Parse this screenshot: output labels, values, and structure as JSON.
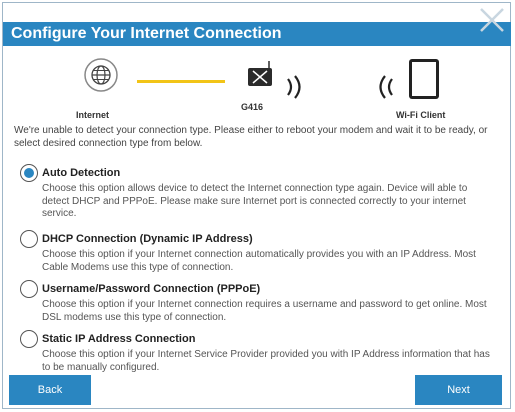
{
  "dialog": {
    "title": "Configure Your Internet Connection",
    "accent_color": "#2a86c1"
  },
  "diagram": {
    "internet_label": "Internet",
    "device_label": "G416",
    "client_label": "Wi-Fi Client",
    "icons": [
      "globe-icon",
      "router-icon",
      "wifi-waves-icon",
      "tablet-icon"
    ]
  },
  "intro_text": "We're unable to detect your connection type. Please either to reboot your modem and wait it to be ready, or select desired connection type from below.",
  "options": [
    {
      "title": "Auto Detection",
      "description": "Choose this option allows device to detect the Internet connection type again. Device will able to detect DHCP and PPPoE. Please make sure Internet port is connected correctly to your internet service.",
      "selected": true
    },
    {
      "title": "DHCP Connection (Dynamic IP Address)",
      "description": "Choose this option if your Internet connection automatically provides you with an IP Address. Most Cable Modems use this type of connection.",
      "selected": false
    },
    {
      "title": "Username/Password Connection (PPPoE)",
      "description": "Choose this option if your Internet connection requires a username and password to get online. Most DSL modems use this type of connection.",
      "selected": false
    },
    {
      "title": "Static IP Address Connection",
      "description": "Choose this option if your Internet Service Provider provided you with IP Address information that has to be manually configured.",
      "selected": false
    }
  ],
  "buttons": {
    "back": "Back",
    "next": "Next"
  }
}
